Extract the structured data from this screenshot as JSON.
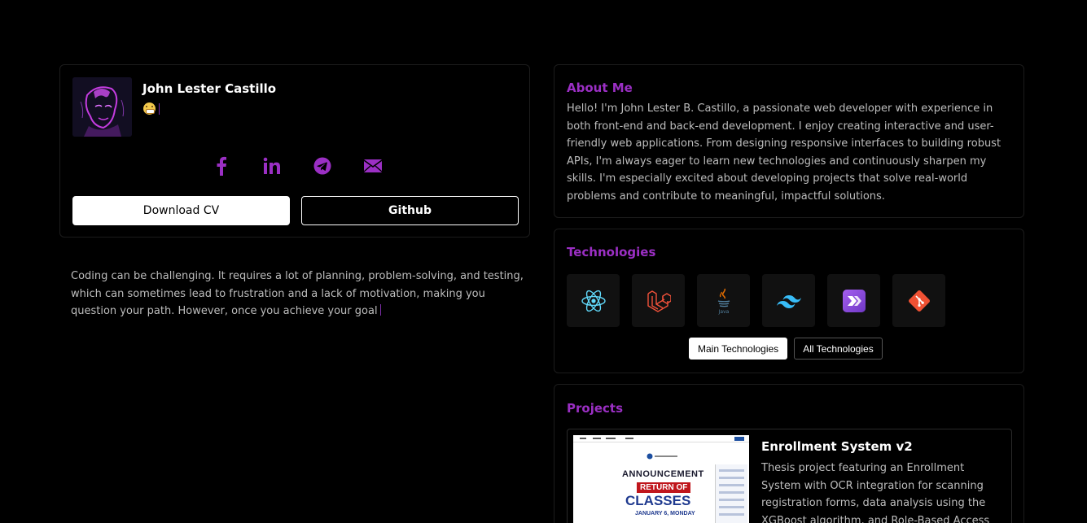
{
  "profile": {
    "name": "John Lester Castillo",
    "status_emoji": "😁",
    "avatar_icon": "avatar-portrait",
    "socials": [
      {
        "name": "facebook-icon"
      },
      {
        "name": "linkedin-icon"
      },
      {
        "name": "telegram-icon"
      },
      {
        "name": "email-icon"
      }
    ],
    "download_cv_label": "Download CV",
    "github_label": "Github"
  },
  "quote": {
    "text": "Coding can be challenging. It requires a lot of planning, problem-solving, and testing, which can sometimes lead to frustration and a lack of motivation, making you question your path. However, once you achieve your goal"
  },
  "about": {
    "title": "About Me",
    "text": "Hello! I'm John Lester B. Castillo, a passionate web developer with experience in both front-end and back-end development. I enjoy creating interactive and user-friendly web applications. From designing responsive interfaces to building robust APIs, I'm always eager to learn new technologies and continuously sharpen my skills. I'm especially excited about developing projects that solve real-world problems and contribute to meaningful, impactful solutions."
  },
  "technologies": {
    "title": "Technologies",
    "items": [
      {
        "icon": "react-icon"
      },
      {
        "icon": "laravel-icon"
      },
      {
        "icon": "java-icon",
        "label": "Java"
      },
      {
        "icon": "tailwind-icon"
      },
      {
        "icon": "power-automate-icon"
      },
      {
        "icon": "git-icon"
      }
    ],
    "tabs": [
      {
        "label": "Main Technologies",
        "active": true
      },
      {
        "label": "All Technologies",
        "active": false
      }
    ]
  },
  "projects": {
    "title": "Projects",
    "items": [
      {
        "title": "Enrollment System v2",
        "description": "Thesis project featuring an Enrollment System with OCR integration for scanning registration forms, data analysis using the XGBoost algorithm, and Role-Based Access Control",
        "thumbnail": {
          "heading": "ANNOUNCEMENT",
          "banner": "RETURN OF",
          "big": "CLASSES",
          "date": "JANUARY 6, MONDAY"
        }
      }
    ]
  },
  "colors": {
    "accent": "#9b2fc4",
    "background": "#000000",
    "text_muted": "#bdbdbd"
  }
}
